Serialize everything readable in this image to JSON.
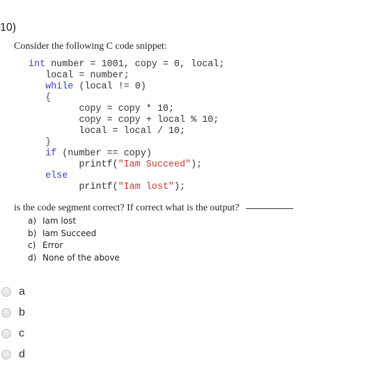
{
  "question": {
    "number": "10)",
    "intro": "Consider the following C code snippet:",
    "code_lines": [
      {
        "indent": "",
        "parts": [
          {
            "t": "int",
            "c": "kw"
          },
          {
            "t": " number = 1001, copy = 0, local;",
            "c": ""
          }
        ]
      },
      {
        "indent": "   ",
        "parts": [
          {
            "t": "local = number;",
            "c": ""
          }
        ]
      },
      {
        "indent": "   ",
        "parts": [
          {
            "t": "while",
            "c": "kw"
          },
          {
            "t": " (local != 0)",
            "c": ""
          }
        ]
      },
      {
        "indent": "   ",
        "parts": [
          {
            "t": "{",
            "c": "punct"
          }
        ]
      },
      {
        "indent": "         ",
        "parts": [
          {
            "t": "copy = copy * 10;",
            "c": ""
          }
        ]
      },
      {
        "indent": "         ",
        "parts": [
          {
            "t": "copy = copy + local % 10;",
            "c": ""
          }
        ]
      },
      {
        "indent": "         ",
        "parts": [
          {
            "t": "local = local / 10;",
            "c": ""
          }
        ]
      },
      {
        "indent": "   ",
        "parts": [
          {
            "t": "}",
            "c": "punct"
          }
        ]
      },
      {
        "indent": "   ",
        "parts": [
          {
            "t": "if",
            "c": "kw"
          },
          {
            "t": " (number == copy)",
            "c": ""
          }
        ]
      },
      {
        "indent": "         ",
        "parts": [
          {
            "t": "printf(",
            "c": ""
          },
          {
            "t": "\"Iam Succeed\"",
            "c": "str"
          },
          {
            "t": ");",
            "c": ""
          }
        ]
      },
      {
        "indent": "   ",
        "parts": [
          {
            "t": "else",
            "c": "kw"
          }
        ]
      },
      {
        "indent": "         ",
        "parts": [
          {
            "t": "printf(",
            "c": ""
          },
          {
            "t": "\"Iam lost\"",
            "c": "str"
          },
          {
            "t": ");",
            "c": ""
          }
        ]
      }
    ],
    "prompt": "is the code segment correct?  If correct what is the output?",
    "choices": [
      {
        "letter": "a)",
        "text": "Iam lost"
      },
      {
        "letter": "b)",
        "text": "Iam Succeed"
      },
      {
        "letter": "c)",
        "text": "Error"
      },
      {
        "letter": "d)",
        "text": "None of the above"
      }
    ]
  },
  "answer_options": [
    {
      "label": "a",
      "selected": false
    },
    {
      "label": "b",
      "selected": false
    },
    {
      "label": "c",
      "selected": false
    },
    {
      "label": "d",
      "selected": false
    }
  ],
  "colors": {
    "keyword": "#3b3fc6",
    "string": "#c0392b"
  }
}
